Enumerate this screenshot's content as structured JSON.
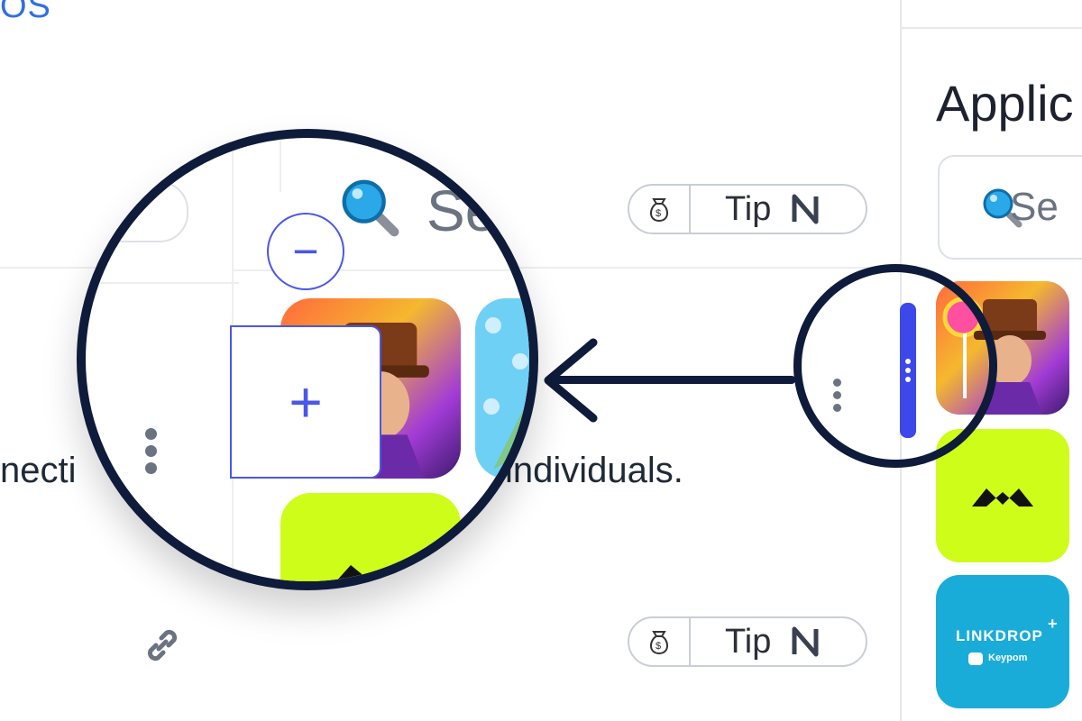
{
  "header": {
    "link_fragment": "OS"
  },
  "right_panel": {
    "title_fragment": "Applic",
    "search_placeholder_fragment": "Se"
  },
  "listing": {
    "description_left": "necti",
    "description_right": "individuals.",
    "tip_button_label": "Tip",
    "tip_currency": "N"
  },
  "apps": [
    {
      "name": "candy-portrait-app",
      "style": "portrait"
    },
    {
      "name": "mintbase-app",
      "style": "lime"
    },
    {
      "name": "linkdrop-app",
      "style": "teal",
      "title": "LINKDROP",
      "subtitle": "Keypom"
    }
  ],
  "magnifier": {
    "search_placeholder_fragment": "Se",
    "minus_symbol": "−",
    "plus_symbol": "+"
  },
  "colors": {
    "accent": "#3d48e8",
    "lime": "#cdfd19",
    "teal": "#19acd9",
    "navy": "#0e1b3a"
  }
}
